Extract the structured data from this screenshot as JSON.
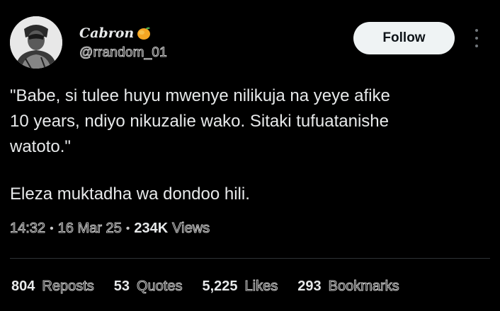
{
  "author": {
    "display_name": "Cabron",
    "emoji_icon": "mango-emoji-icon",
    "handle": "@rrandom_01",
    "avatar_icon": "avatar-photo"
  },
  "actions": {
    "follow_label": "Follow",
    "more_icon": "more-vertical-icon"
  },
  "tweet": {
    "text": "\"Babe, si tulee huyu mwenye nilikuja na yeye afike\n10 years, ndiyo nikuzalie wako. Sitaki tufuatanishe\nwatoto.\"",
    "text_second": "Eleza muktadha wa dondoo hili."
  },
  "meta": {
    "time": "14:32",
    "date": "16 Mar 25",
    "views_count": "234K",
    "views_label": "Views"
  },
  "stats": [
    {
      "count": "804",
      "label": "Reposts"
    },
    {
      "count": "53",
      "label": "Quotes"
    },
    {
      "count": "5,225",
      "label": "Likes"
    },
    {
      "count": "293",
      "label": "Bookmarks"
    }
  ],
  "colors": {
    "background": "#000000",
    "text": "#e7e9ea",
    "button_bg": "#eff3f4",
    "divider": "#2f3336",
    "secondary": "#71767b"
  }
}
